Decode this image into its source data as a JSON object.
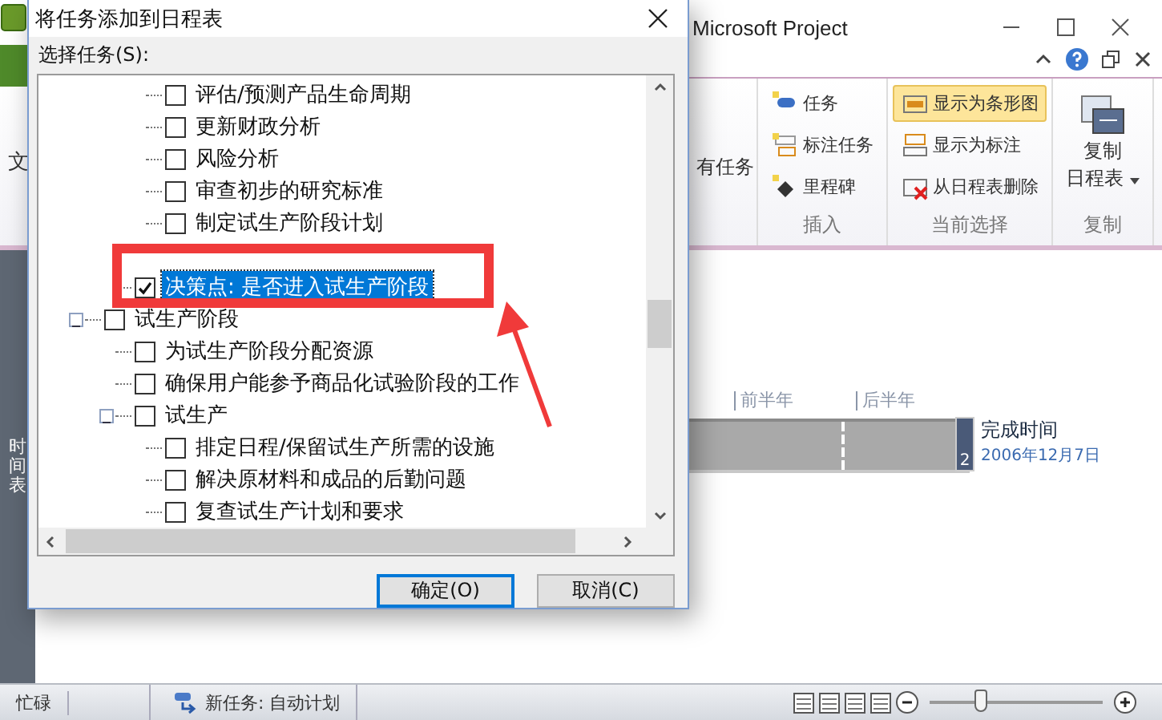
{
  "app": {
    "title": "Microsoft Project",
    "file_tab": "文",
    "ribbon": {
      "partial_button": "有任务",
      "groups": [
        {
          "label": "插入",
          "kind": "small",
          "buttons": [
            {
              "label": "任务",
              "selected": false
            },
            {
              "label": "标注任务",
              "selected": false
            },
            {
              "label": "里程碑",
              "selected": false
            }
          ]
        },
        {
          "label": "当前选择",
          "kind": "small",
          "buttons": [
            {
              "label": "显示为条形图",
              "selected": true
            },
            {
              "label": "显示为标注",
              "selected": false
            },
            {
              "label": "从日程表删除",
              "selected": false
            }
          ]
        },
        {
          "label": "复制",
          "kind": "large",
          "buttons": [
            {
              "label": "复制",
              "sub_label": "日程表",
              "selected": false
            }
          ]
        }
      ]
    },
    "timeline": {
      "label": "时间表",
      "periods": [
        "前半年",
        "后半年"
      ],
      "marker": "2",
      "finish_label": "完成时间",
      "finish_date": "2006年12月7日"
    },
    "status_bar": {
      "mode": "忙碌",
      "new_task": "新任务: 自动计划",
      "zoom": {
        "level": 0.3
      }
    }
  },
  "dialog": {
    "title": "将任务添加到日程表",
    "list_label": "选择任务(S):",
    "tree": [
      {
        "children": [
          {
            "children": [
              {
                "label": "评估/预测产品生命周期",
                "checked": false,
                "selected": false
              },
              {
                "label": "更新财政分析",
                "checked": false,
                "selected": false
              },
              {
                "label": "风险分析",
                "checked": false,
                "selected": false
              },
              {
                "label": "审查初步的研究标准",
                "checked": false,
                "selected": false
              },
              {
                "label": "制定试生产阶段计划",
                "checked": false,
                "selected": false
              }
            ]
          },
          {
            "label": "决策点: 是否进入试生产阶段",
            "checked": true,
            "selected": true
          }
        ]
      },
      {
        "label": "试生产阶段",
        "checked": false,
        "selected": false,
        "expanded": true,
        "children": [
          {
            "label": "为试生产阶段分配资源",
            "checked": false,
            "selected": false
          },
          {
            "label": "确保用户能参予商品化试验阶段的工作",
            "checked": false,
            "selected": false
          },
          {
            "label": "试生产",
            "checked": false,
            "selected": false,
            "expanded": true,
            "children": [
              {
                "label": "排定日程/保留试生产所需的设施",
                "checked": false,
                "selected": false
              },
              {
                "label": "解决原材料和成品的后勤问题",
                "checked": false,
                "selected": false
              },
              {
                "label": "复查试生产计划和要求",
                "checked": false,
                "selected": false
              }
            ]
          }
        ]
      }
    ],
    "buttons": [
      {
        "label": "确定(O)",
        "default": true
      },
      {
        "label": "取消(C)",
        "default": false
      }
    ]
  }
}
